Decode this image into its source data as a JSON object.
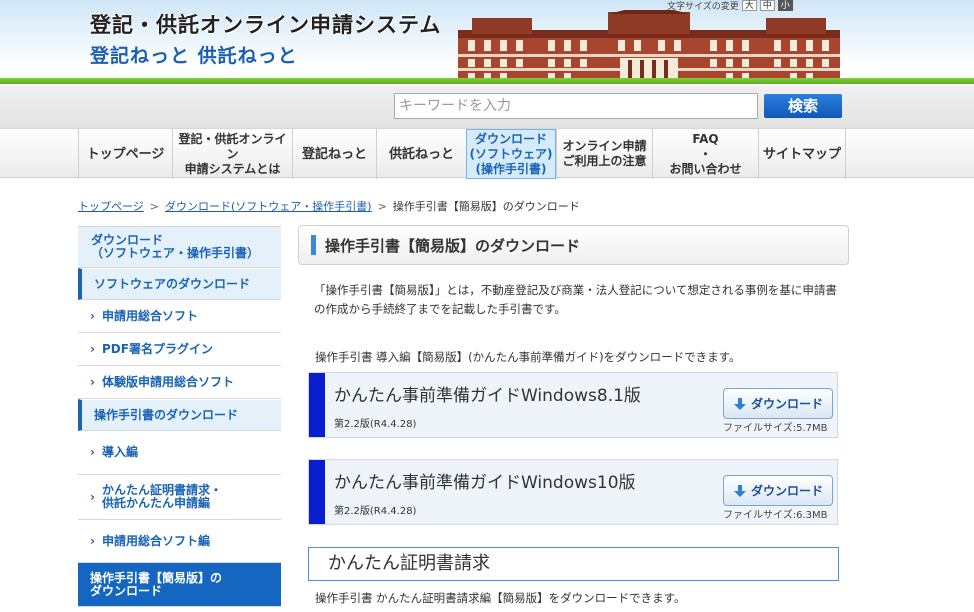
{
  "header": {
    "title_main": "登記・供託オンライン申請システム",
    "title_sub": "登記ねっと 供託ねっと",
    "font_size_label": "文字サイズの変更",
    "font_sizes": [
      "大",
      "中",
      "小"
    ],
    "selected_font_size": "小"
  },
  "search": {
    "placeholder": "キーワードを入力",
    "button_label": "検索"
  },
  "nav": {
    "items": [
      {
        "label": "トップページ"
      },
      {
        "label": "登記・供託オンライン\n申請システムとは"
      },
      {
        "label": "登記ねっと"
      },
      {
        "label": "供託ねっと"
      },
      {
        "label": "ダウンロード\n(ソフトウェア)\n(操作手引書)"
      },
      {
        "label": "オンライン申請\nご利用上の注意"
      },
      {
        "label": "FAQ\n・\nお問い合わせ"
      },
      {
        "label": "サイトマップ"
      }
    ],
    "current_index": 4
  },
  "breadcrumb": {
    "home": "トップページ",
    "parent": "ダウンロード(ソフトウェア・操作手引書)",
    "current": "操作手引書【簡易版】のダウンロード",
    "sep": ">"
  },
  "sidebar": {
    "head": "ダウンロード\n（ソフトウェア・操作手引書）",
    "software_section": "ソフトウェアのダウンロード",
    "software_items": [
      "申請用総合ソフト",
      "PDF署名プラグイン",
      "体験版申請用総合ソフト"
    ],
    "manual_section": "操作手引書のダウンロード",
    "manual_items": [
      "導入編",
      "かんたん証明書請求・\n供託かんたん申請編",
      "申請用総合ソフト編"
    ],
    "active": "操作手引書【簡易版】の\nダウンロード"
  },
  "main": {
    "heading": "操作手引書【簡易版】のダウンロード",
    "intro": "「操作手引書【簡易版】」とは，不動産登記及び商業・法人登記について想定される事例を基に申請書の作成から手続終了までを記載した手引書です。",
    "lead1": "操作手引書 導入編【簡易版】(かんたん事前準備ガイド)をダウンロードできます。",
    "downloads": [
      {
        "title": "かんたん事前準備ガイドWindows8.1版",
        "version": "第2.2版(R4.4.28)",
        "button": "ダウンロード",
        "size": "ファイルサイズ:5.7MB"
      },
      {
        "title": "かんたん事前準備ガイドWindows10版",
        "version": "第2.2版(R4.4.28)",
        "button": "ダウンロード",
        "size": "ファイルサイズ:6.3MB"
      }
    ],
    "section2_title": "かんたん証明書請求",
    "lead2": "操作手引書 かんたん証明書請求編【簡易版】をダウンロードできます。"
  },
  "colors": {
    "accent": "#1566c0",
    "card_stripe": "#0a1ed0",
    "search_button": "#1a63c8"
  }
}
